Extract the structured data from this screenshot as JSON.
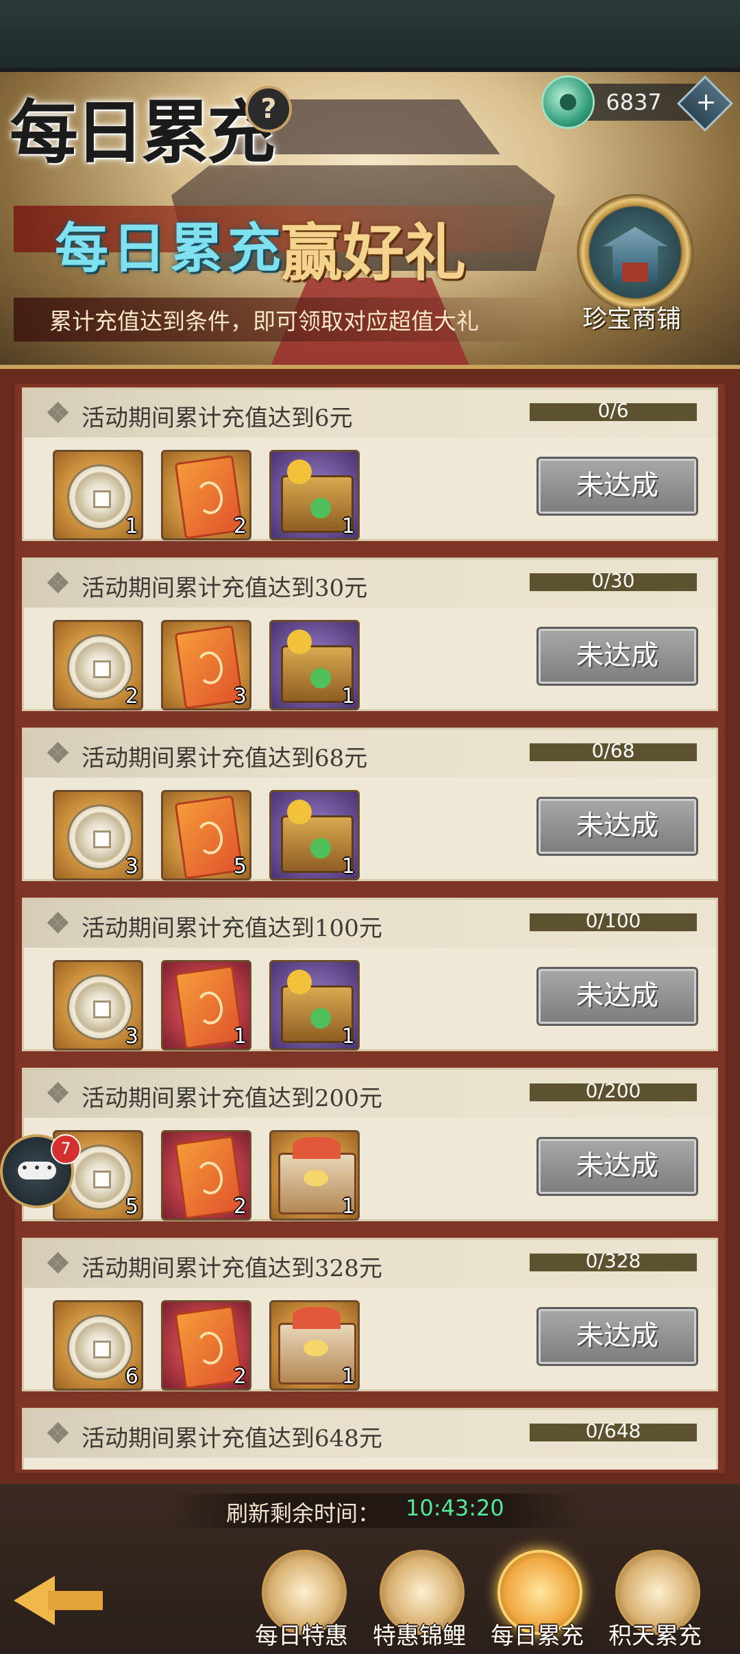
{
  "header": {
    "title": "每日累充",
    "help_icon": "question-mark-icon",
    "currency": {
      "icon": "jade-coin-icon",
      "value": "6837",
      "add_icon": "plus-icon"
    }
  },
  "banner": {
    "headline_a": "每日累充",
    "headline_b": "赢好礼",
    "subtitle": "累计充值达到条件，即可领取对应超值大礼",
    "shop_label": "珍宝商铺"
  },
  "tiers": [
    {
      "title": "活动期间累计充值达到6元",
      "progress": "0/6",
      "progress_ratio": 0,
      "rewards": [
        {
          "icon": "copper-coin-icon",
          "count": "1"
        },
        {
          "icon": "orange-envelope-icon",
          "count": "2"
        },
        {
          "icon": "treasure-chest-icon",
          "count": "1"
        }
      ],
      "button": "未达成"
    },
    {
      "title": "活动期间累计充值达到30元",
      "progress": "0/30",
      "progress_ratio": 0,
      "rewards": [
        {
          "icon": "copper-coin-icon",
          "count": "2"
        },
        {
          "icon": "orange-envelope-icon",
          "count": "3"
        },
        {
          "icon": "treasure-chest-icon",
          "count": "1"
        }
      ],
      "button": "未达成"
    },
    {
      "title": "活动期间累计充值达到68元",
      "progress": "0/68",
      "progress_ratio": 0,
      "rewards": [
        {
          "icon": "copper-coin-icon",
          "count": "3"
        },
        {
          "icon": "orange-envelope-icon",
          "count": "5"
        },
        {
          "icon": "treasure-chest-icon",
          "count": "1"
        }
      ],
      "button": "未达成"
    },
    {
      "title": "活动期间累计充值达到100元",
      "progress": "0/100",
      "progress_ratio": 0,
      "rewards": [
        {
          "icon": "copper-coin-icon",
          "count": "3"
        },
        {
          "icon": "red-dragon-envelope-icon",
          "count": "1"
        },
        {
          "icon": "treasure-chest-icon",
          "count": "1"
        }
      ],
      "button": "未达成"
    },
    {
      "title": "活动期间累计充值达到200元",
      "progress": "0/200",
      "progress_ratio": 0,
      "rewards": [
        {
          "icon": "copper-coin-icon",
          "count": "5"
        },
        {
          "icon": "red-dragon-envelope-icon",
          "count": "2"
        },
        {
          "icon": "grand-chest-icon",
          "count": "1"
        }
      ],
      "button": "未达成"
    },
    {
      "title": "活动期间累计充值达到328元",
      "progress": "0/328",
      "progress_ratio": 0,
      "rewards": [
        {
          "icon": "copper-coin-icon",
          "count": "6"
        },
        {
          "icon": "red-dragon-envelope-icon",
          "count": "2"
        },
        {
          "icon": "grand-chest-icon",
          "count": "1"
        }
      ],
      "button": "未达成"
    },
    {
      "title": "活动期间累计充值达到648元",
      "progress": "0/648",
      "progress_ratio": 0,
      "rewards": [],
      "button": ""
    }
  ],
  "chat": {
    "icon": "chat-bubble-icon",
    "badge": "7"
  },
  "footer": {
    "timer_label": "刷新剩余时间：",
    "timer_value": "10:43:20",
    "back_icon": "back-arrow-icon",
    "tabs": [
      {
        "label": "每日特惠",
        "icon": "daily-deal-icon",
        "active": false
      },
      {
        "label": "特惠锦鲤",
        "icon": "koi-fish-icon",
        "active": false
      },
      {
        "label": "每日累充",
        "icon": "money-bag-icon",
        "active": true
      },
      {
        "label": "积天累充",
        "icon": "scroll-gift-icon",
        "active": false
      }
    ]
  },
  "colors": {
    "timer": "#54e89a",
    "accent_gold": "#c9a45c",
    "button_disabled": "#8c8c8c"
  }
}
